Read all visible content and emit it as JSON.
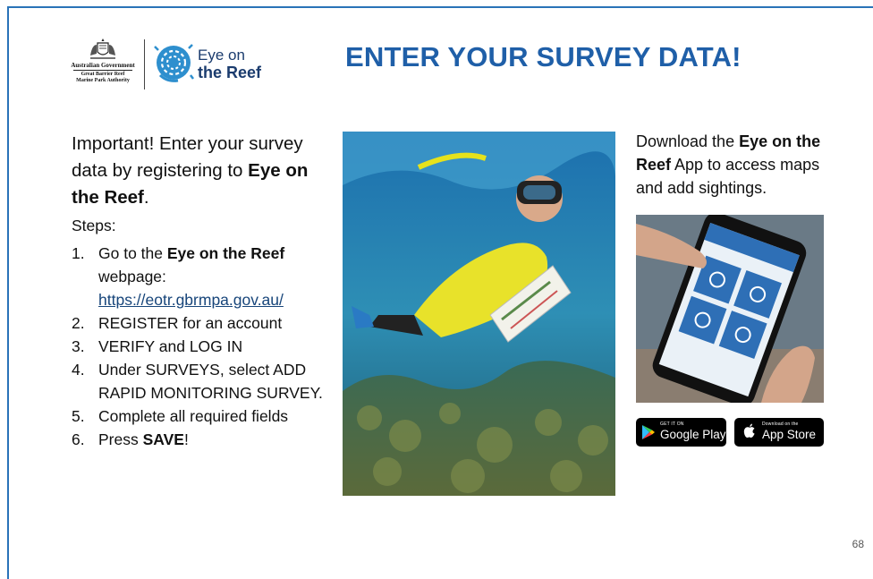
{
  "header": {
    "gov": {
      "name": "Australian Government",
      "agency_line1": "Great Barrier Reef",
      "agency_line2": "Marine Park Authority"
    },
    "eye_logo": {
      "line1": "Eye on",
      "line2": "the Reef"
    },
    "title": "ENTER YOUR SURVEY DATA!"
  },
  "left": {
    "intro_prefix": "Important! Enter your survey data by registering to ",
    "intro_bold": "Eye on the Reef",
    "intro_suffix": ".",
    "steps_heading": "Steps:",
    "steps": [
      {
        "num": "1.",
        "prefix": "Go to the ",
        "bold": "Eye on the Reef",
        "suffix": " webpage:",
        "link": "https://eotr.gbrmpa.gov.au/"
      },
      {
        "num": "2.",
        "text": "REGISTER for an account"
      },
      {
        "num": "3.",
        "text": "VERIFY and LOG IN"
      },
      {
        "num": "4.",
        "text": "Under SURVEYS, select ADD RAPID MONITORING SURVEY."
      },
      {
        "num": "5.",
        "text": "Complete all required fields"
      },
      {
        "num": "6.",
        "prefix": "Press ",
        "bold": "SAVE",
        "suffix": "!"
      }
    ]
  },
  "right": {
    "download_prefix": "Download the ",
    "download_bold": "Eye on the Reef",
    "download_suffix": " App to access maps and add sightings.",
    "google_play": {
      "small": "GET IT ON",
      "big": "Google Play"
    },
    "app_store": {
      "small": "Download on the",
      "big": "App Store"
    }
  },
  "page_number": "68",
  "colors": {
    "title": "#1f5fa8",
    "frame": "#2a73b8",
    "logo_blue": "#1b3c6e",
    "link": "#17457a"
  }
}
